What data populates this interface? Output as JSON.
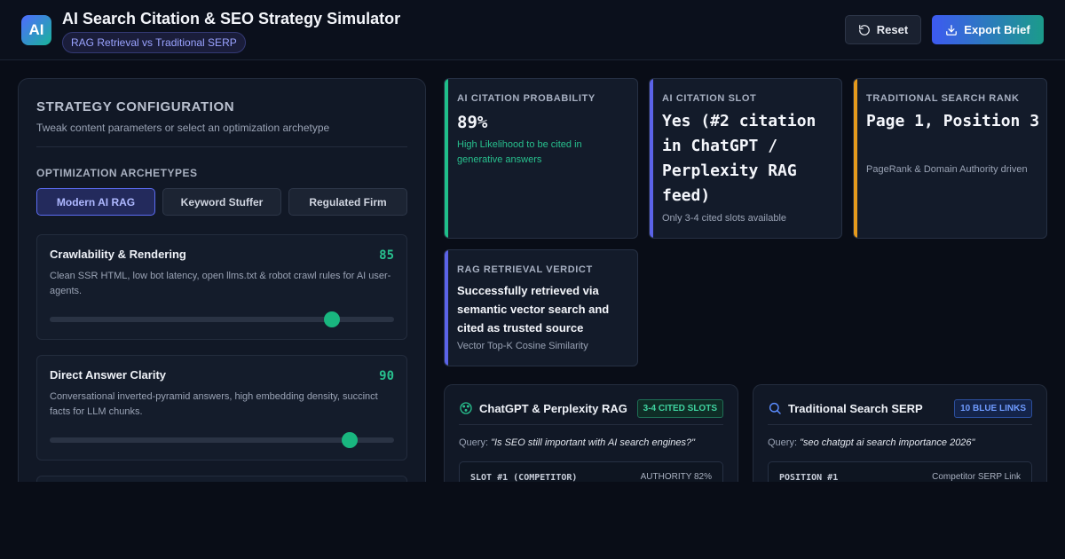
{
  "header": {
    "logo_text": "AI",
    "title": "AI Search Citation & SEO Strategy Simulator",
    "subtitle": "RAG Retrieval vs Traditional SERP",
    "reset_label": "Reset",
    "export_label": "Export Brief"
  },
  "config": {
    "title": "STRATEGY CONFIGURATION",
    "subtitle": "Tweak content parameters or select an optimization archetype",
    "archetypes_label": "OPTIMIZATION ARCHETYPES",
    "archetypes": [
      "Modern AI RAG",
      "Keyword Stuffer",
      "Regulated Firm"
    ],
    "active_archetype": "Modern AI RAG",
    "params": [
      {
        "name": "Crawlability & Rendering",
        "value": "85",
        "level": 0.82,
        "description": "Clean SSR HTML, low bot latency, open llms.txt & robot crawl rules for AI user-agents."
      },
      {
        "name": "Direct Answer Clarity",
        "value": "90",
        "level": 0.87,
        "description": "Conversational inverted-pyramid answers, high embedding density, succinct facts for LLM chunks."
      }
    ]
  },
  "metrics": {
    "probability": {
      "label": "AI CITATION PROBABILITY",
      "value": "89%",
      "note": "High Likelihood to be cited in generative answers",
      "color": "#1fbf8a"
    },
    "slot": {
      "label": "AI CITATION SLOT",
      "value": "Yes (#2 citation in ChatGPT / Perplexity RAG feed)",
      "note": "Only 3-4 cited slots available",
      "color": "#5b63e8"
    },
    "rank": {
      "label": "TRADITIONAL SEARCH RANK",
      "value": "Page 1, Position 3",
      "note": "PageRank & Domain Authority driven",
      "color": "#e59a1c"
    },
    "verdict": {
      "label": "RAG RETRIEVAL VERDICT",
      "value": "Successfully retrieved via semantic vector search and cited as trusted source",
      "note": "Vector Top-K Cosine Similarity",
      "color": "#5b63e8"
    }
  },
  "rag_panel": {
    "title": "ChatGPT & Perplexity RAG",
    "badge": "3-4 CITED SLOTS",
    "query_label": "Query:",
    "query": "\"Is SEO still important with AI search engines?\"",
    "slot_name": "SLOT #1 (COMPETITOR)",
    "slot_meta": "AUTHORITY 82%"
  },
  "serp_panel": {
    "title": "Traditional Search SERP",
    "badge": "10 BLUE LINKS",
    "query_label": "Query:",
    "query": "\"seo chatgpt ai search importance 2026\"",
    "slot_name": "POSITION #1",
    "slot_meta": "Competitor SERP Link"
  }
}
